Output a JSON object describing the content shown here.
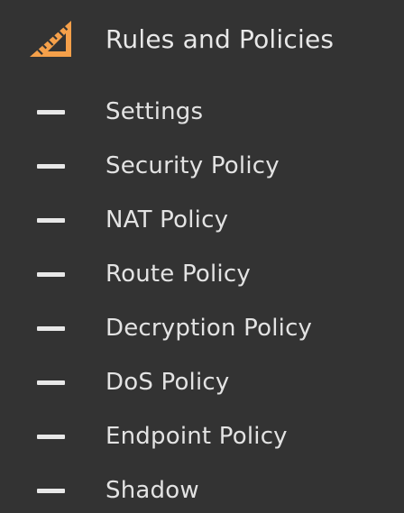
{
  "nav": {
    "section": {
      "title": "Rules and Policies",
      "icon": "set-square-ruler-icon",
      "icon_color": "#f5a04a"
    },
    "items": [
      {
        "label": "Settings",
        "icon": "dash-icon"
      },
      {
        "label": "Security Policy",
        "icon": "dash-icon"
      },
      {
        "label": "NAT Policy",
        "icon": "dash-icon"
      },
      {
        "label": "Route Policy",
        "icon": "dash-icon"
      },
      {
        "label": "Decryption Policy",
        "icon": "dash-icon"
      },
      {
        "label": "DoS Policy",
        "icon": "dash-icon"
      },
      {
        "label": "Endpoint Policy",
        "icon": "dash-icon"
      },
      {
        "label": "Shadow",
        "icon": "dash-icon"
      }
    ]
  },
  "colors": {
    "background": "#333333",
    "text": "#e6e6e6",
    "accent": "#f5a04a"
  }
}
